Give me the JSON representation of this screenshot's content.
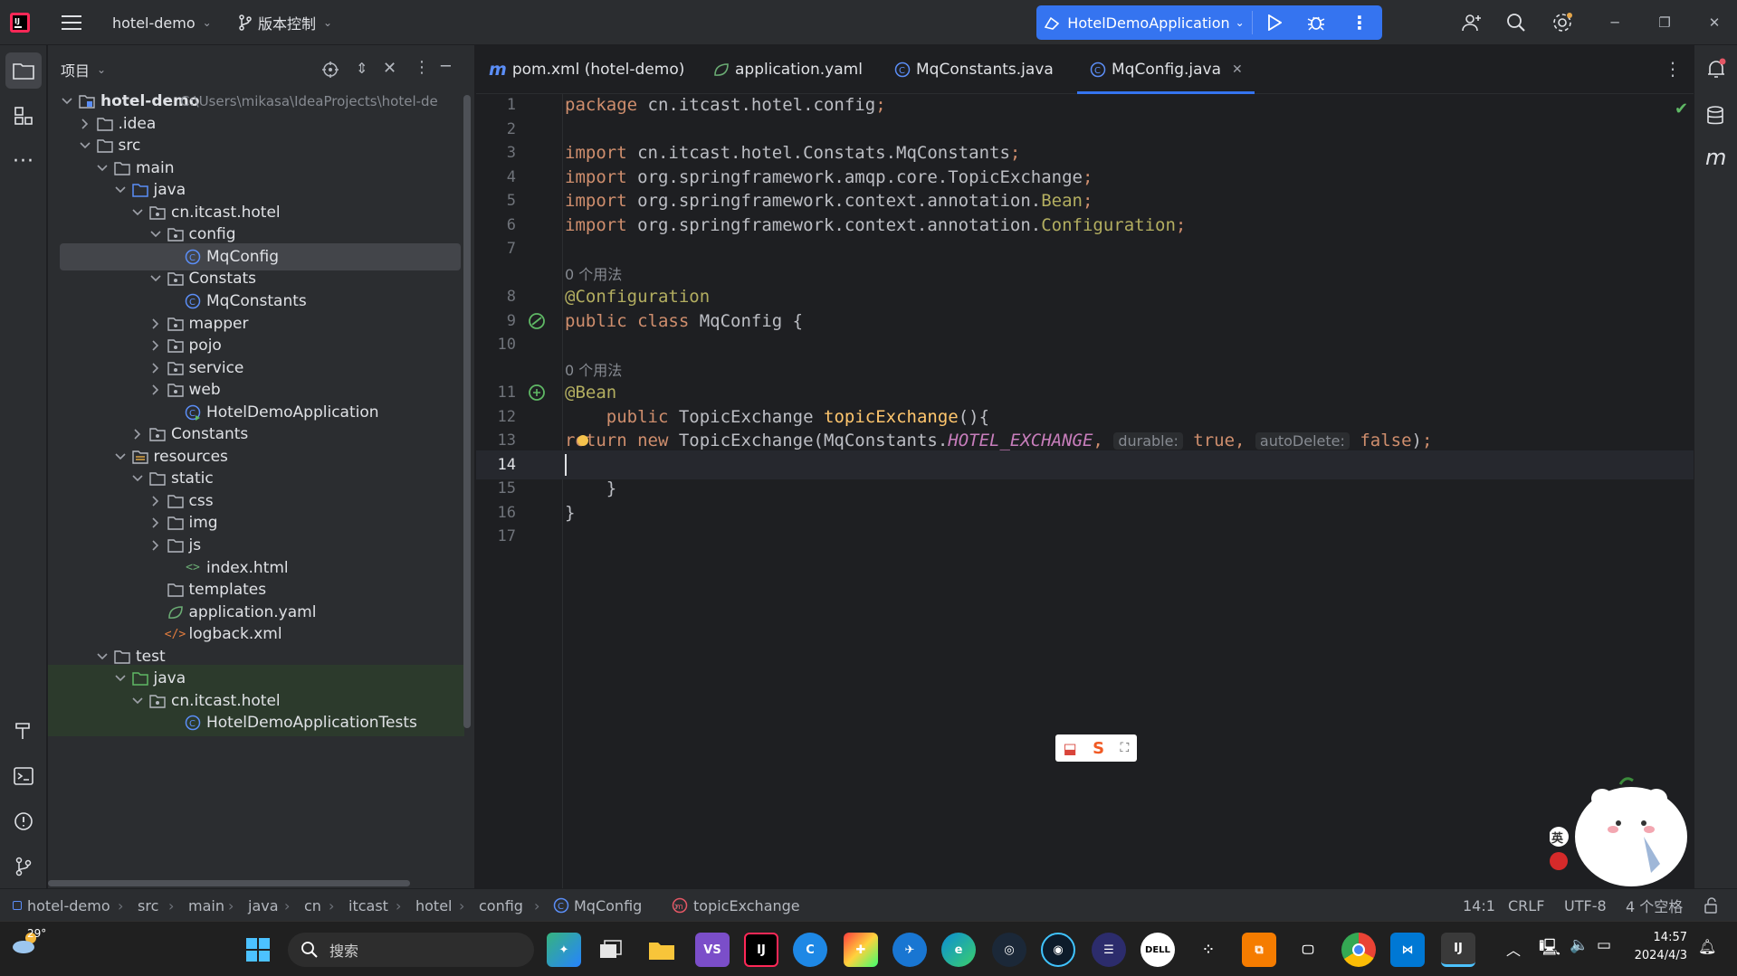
{
  "titlebar": {
    "project_name": "hotel-demo",
    "vcs_label": "版本控制",
    "run_config": "HotelDemoApplication"
  },
  "project_panel": {
    "title": "项目",
    "tree": [
      {
        "label": "hotel-demo",
        "extra": "C:\\Users\\mikasa\\IdeaProjects\\hotel-de",
        "level": 0,
        "expanded": true,
        "type": "module"
      },
      {
        "label": ".idea",
        "level": 1,
        "expanded": false,
        "type": "folder"
      },
      {
        "label": "src",
        "level": 1,
        "expanded": true,
        "type": "folder"
      },
      {
        "label": "main",
        "level": 2,
        "expanded": true,
        "type": "folder"
      },
      {
        "label": "java",
        "level": 3,
        "expanded": true,
        "type": "source-folder"
      },
      {
        "label": "cn.itcast.hotel",
        "level": 4,
        "expanded": true,
        "type": "package"
      },
      {
        "label": "config",
        "level": 5,
        "expanded": true,
        "type": "package"
      },
      {
        "label": "MqConfig",
        "level": 6,
        "type": "class",
        "selected": true
      },
      {
        "label": "Constats",
        "level": 5,
        "expanded": true,
        "type": "package"
      },
      {
        "label": "MqConstants",
        "level": 6,
        "type": "class"
      },
      {
        "label": "mapper",
        "level": 5,
        "expanded": false,
        "type": "package"
      },
      {
        "label": "pojo",
        "level": 5,
        "expanded": false,
        "type": "package"
      },
      {
        "label": "service",
        "level": 5,
        "expanded": false,
        "type": "package"
      },
      {
        "label": "web",
        "level": 5,
        "expanded": false,
        "type": "package"
      },
      {
        "label": "HotelDemoApplication",
        "level": 6,
        "type": "app-class"
      },
      {
        "label": "Constants",
        "level": 4,
        "expanded": false,
        "type": "package"
      },
      {
        "label": "resources",
        "level": 3,
        "expanded": true,
        "type": "resources"
      },
      {
        "label": "static",
        "level": 4,
        "expanded": true,
        "type": "folder"
      },
      {
        "label": "css",
        "level": 5,
        "expanded": false,
        "type": "folder"
      },
      {
        "label": "img",
        "level": 5,
        "expanded": false,
        "type": "folder"
      },
      {
        "label": "js",
        "level": 5,
        "expanded": false,
        "type": "folder"
      },
      {
        "label": "index.html",
        "level": 6,
        "type": "html"
      },
      {
        "label": "templates",
        "level": 5,
        "type": "folder-plain"
      },
      {
        "label": "application.yaml",
        "level": 5,
        "type": "yaml"
      },
      {
        "label": "logback.xml",
        "level": 5,
        "type": "xml"
      },
      {
        "label": "test",
        "level": 2,
        "expanded": true,
        "type": "folder"
      },
      {
        "label": "java",
        "level": 3,
        "expanded": true,
        "type": "test-folder",
        "test": true
      },
      {
        "label": "cn.itcast.hotel",
        "level": 4,
        "expanded": true,
        "type": "package",
        "test": true
      },
      {
        "label": "HotelDemoApplicationTests",
        "level": 6,
        "type": "class",
        "test": true
      }
    ]
  },
  "tabs": [
    {
      "label": "pom.xml (hotel-demo)",
      "icon": "maven-icon"
    },
    {
      "label": "application.yaml",
      "icon": "yaml-icon"
    },
    {
      "label": "MqConstants.java",
      "icon": "class-icon"
    },
    {
      "label": "MqConfig.java",
      "icon": "class-icon",
      "active": true
    }
  ],
  "editor": {
    "current_line": 14,
    "usage_hint": "0 个用法",
    "lines": [
      {
        "n": "1",
        "tokens": [
          [
            "kw",
            "package "
          ],
          [
            "id",
            "cn.itcast.hotel.config"
          ],
          [
            "kw",
            ";"
          ]
        ]
      },
      {
        "n": "2",
        "tokens": []
      },
      {
        "n": "3",
        "tokens": [
          [
            "kw",
            "import "
          ],
          [
            "id",
            "cn.itcast.hotel.Constats.MqConstants"
          ],
          [
            "kw",
            ";"
          ]
        ]
      },
      {
        "n": "4",
        "tokens": [
          [
            "kw",
            "import "
          ],
          [
            "id",
            "org.springframework.amqp.core.TopicExchange"
          ],
          [
            "kw",
            ";"
          ]
        ]
      },
      {
        "n": "5",
        "tokens": [
          [
            "kw",
            "import "
          ],
          [
            "id",
            "org.springframework.context.annotation."
          ],
          [
            "ann",
            "Bean"
          ],
          [
            "kw",
            ";"
          ]
        ]
      },
      {
        "n": "6",
        "tokens": [
          [
            "kw",
            "import "
          ],
          [
            "id",
            "org.springframework.context.annotation."
          ],
          [
            "ann",
            "Configuration"
          ],
          [
            "kw",
            ";"
          ]
        ]
      },
      {
        "n": "7",
        "tokens": []
      },
      {
        "n": "",
        "hint": true
      },
      {
        "n": "8",
        "tokens": [
          [
            "ann",
            "@Configuration"
          ]
        ]
      },
      {
        "n": "9",
        "tokens": [
          [
            "kw",
            "public class "
          ],
          [
            "id",
            "MqConfig {"
          ]
        ]
      },
      {
        "n": "10",
        "tokens": []
      },
      {
        "n": "",
        "hint": true
      },
      {
        "n": "11",
        "tokens": [
          [
            "ann",
            "@Bean"
          ]
        ]
      },
      {
        "n": "12",
        "tokens": [
          [
            "id",
            "    "
          ],
          [
            "kw",
            "public "
          ],
          [
            "id",
            "TopicExchange "
          ],
          [
            "fnc",
            "topicExchange"
          ],
          [
            "id",
            "(){"
          ]
        ]
      },
      {
        "n": "13",
        "tokens": [
          [
            "kw",
            "return new "
          ],
          [
            "id",
            "TopicExchange(MqConstants."
          ],
          [
            "cst",
            "HOTEL_EXCHANGE"
          ],
          [
            "kw",
            ", "
          ],
          [
            "inlay",
            "durable:"
          ],
          [
            "kw",
            " true, "
          ],
          [
            "inlay",
            "autoDelete:"
          ],
          [
            "kw",
            " false"
          ],
          [
            "id",
            ")"
          ],
          [
            "kw",
            ";"
          ]
        ]
      },
      {
        "n": "14",
        "tokens": []
      },
      {
        "n": "15",
        "tokens": [
          [
            "id",
            "    }"
          ]
        ]
      },
      {
        "n": "16",
        "tokens": [
          [
            "id",
            "}"
          ]
        ]
      },
      {
        "n": "17",
        "tokens": []
      }
    ]
  },
  "statusbar": {
    "breadcrumbs": [
      "hotel-demo",
      "src",
      "main",
      "java",
      "cn",
      "itcast",
      "hotel",
      "config",
      "MqConfig",
      "topicExchange"
    ],
    "position": "14:1",
    "line_ending": "CRLF",
    "encoding": "UTF-8",
    "indent": "4 个空格"
  },
  "taskbar": {
    "weather": "29°",
    "search_placeholder": "搜索",
    "time": "14:57",
    "date": "2024/4/3",
    "ime": "英"
  },
  "colors": {
    "accent": "#3574f0",
    "keyword": "#cf8e6d",
    "annotation": "#b3ae60",
    "constant": "#c77dbb",
    "method": "#ffc66d"
  }
}
